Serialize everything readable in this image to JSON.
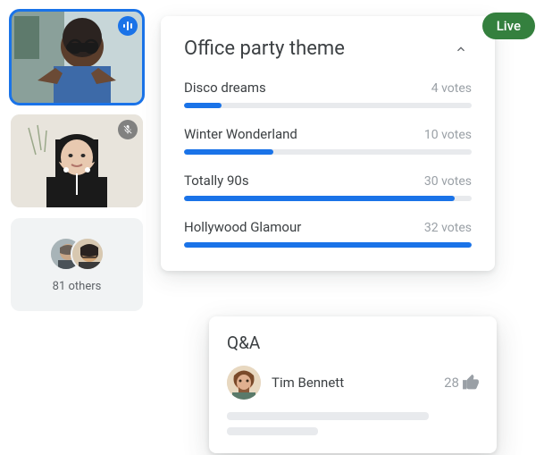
{
  "live_badge": "Live",
  "participants": {
    "tile1": {
      "status_icon": "speaking-indicator-icon"
    },
    "tile2": {
      "status_icon": "mic-muted-icon"
    },
    "others_label": "81 others"
  },
  "poll": {
    "title": "Office party theme",
    "collapse_icon": "chevron-up-icon",
    "options": [
      {
        "label": "Disco dreams",
        "votes_text": "4 votes",
        "votes": 4
      },
      {
        "label": "Winter Wonderland",
        "votes_text": "10 votes",
        "votes": 10
      },
      {
        "label": "Totally 90s",
        "votes_text": "30 votes",
        "votes": 30
      },
      {
        "label": "Hollywood Glamour",
        "votes_text": "32 votes",
        "votes": 32
      }
    ],
    "max_votes": 32
  },
  "qa": {
    "title": "Q&A",
    "entry": {
      "name": "Tim Bennett",
      "upvotes": "28",
      "upvote_icon": "thumbs-up-icon"
    }
  },
  "chart_data": {
    "type": "bar",
    "title": "Office party theme",
    "categories": [
      "Disco dreams",
      "Winter Wonderland",
      "Totally 90s",
      "Hollywood Glamour"
    ],
    "values": [
      4,
      10,
      30,
      32
    ],
    "xlabel": "",
    "ylabel": "votes",
    "ylim": [
      0,
      32
    ]
  }
}
